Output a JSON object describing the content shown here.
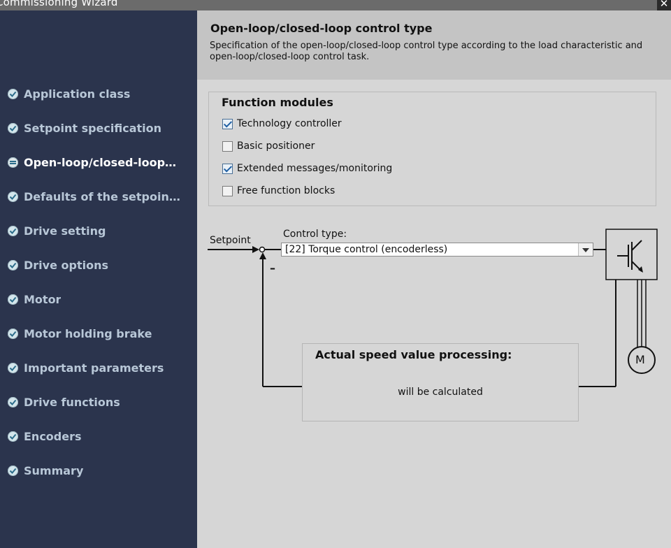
{
  "window": {
    "title": "Commissioning Wizard",
    "close_glyph": "✕"
  },
  "sidebar": {
    "items": [
      {
        "label": "Application class",
        "state": "done"
      },
      {
        "label": "Setpoint specification",
        "state": "done"
      },
      {
        "label": "Open-loop/closed-loop…",
        "state": "active"
      },
      {
        "label": "Defaults of the setpoin…",
        "state": "done"
      },
      {
        "label": "Drive setting",
        "state": "done"
      },
      {
        "label": "Drive options",
        "state": "done"
      },
      {
        "label": "Motor",
        "state": "done"
      },
      {
        "label": "Motor holding brake",
        "state": "done"
      },
      {
        "label": "Important parameters",
        "state": "done"
      },
      {
        "label": "Drive functions",
        "state": "done"
      },
      {
        "label": "Encoders",
        "state": "done"
      },
      {
        "label": "Summary",
        "state": "done"
      }
    ]
  },
  "header": {
    "title": "Open-loop/closed-loop control type",
    "description": "Specification of the open-loop/closed-loop control type according to the load characteristic and open-loop/closed-loop control task."
  },
  "function_modules": {
    "title": "Function modules",
    "options": [
      {
        "label": "Technology controller",
        "checked": true
      },
      {
        "label": "Basic positioner",
        "checked": false
      },
      {
        "label": "Extended messages/monitoring",
        "checked": true
      },
      {
        "label": "Free function blocks",
        "checked": false
      }
    ]
  },
  "diagram": {
    "setpoint_label": "Setpoint",
    "control_type_label": "Control type:",
    "control_type_value": "[22] Torque control (encoderless)",
    "minus_sign": "–",
    "motor_label": "M",
    "speed_box_title": "Actual speed value processing:",
    "speed_box_value": "will be calculated"
  },
  "colors": {
    "sidebar_bg": "#2b344d",
    "sidebar_text": "#b8c7d7",
    "active_text": "#ffffff",
    "content_bg": "#d6d6d6",
    "header_bg": "#c4c4c4"
  }
}
